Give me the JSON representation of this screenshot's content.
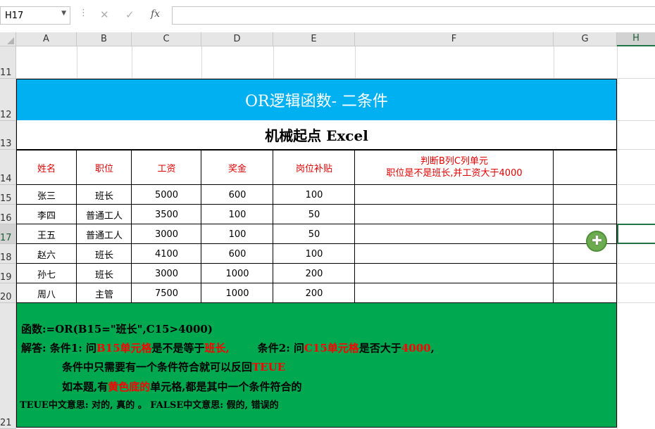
{
  "formula_bar": {
    "name_box": "H17",
    "cancel_icon": "✕",
    "enter_icon": "✓",
    "fx_label": "fx",
    "formula": ""
  },
  "columns": [
    "A",
    "B",
    "C",
    "D",
    "E",
    "F",
    "G",
    "H"
  ],
  "rows": [
    "11",
    "12",
    "13",
    "14",
    "15",
    "16",
    "17",
    "18",
    "19",
    "20",
    "21"
  ],
  "title": "OR逻辑函数- 二条件",
  "subtitle": "机械起点 Excel",
  "table": {
    "headers": [
      "姓名",
      "职位",
      "工资",
      "奖金",
      "岗位补贴"
    ],
    "judge_header_line1": "判断B列C列单元",
    "judge_header_line2": "职位是不是班长,并工资大于4000",
    "rows": [
      [
        "张三",
        "班长",
        "5000",
        "600",
        "100"
      ],
      [
        "李四",
        "普通工人",
        "3500",
        "100",
        "50"
      ],
      [
        "王五",
        "普通工人",
        "3000",
        "100",
        "50"
      ],
      [
        "赵六",
        "班长",
        "4100",
        "600",
        "100"
      ],
      [
        "孙七",
        "班长",
        "3000",
        "1000",
        "200"
      ],
      [
        "周八",
        "主管",
        "7500",
        "1000",
        "200"
      ]
    ]
  },
  "notes": {
    "line1": "函数:=OR(B15=\"班长\",C15>4000)",
    "line2_a": "解答: 条件1: 问",
    "line2_b": "B15单元格",
    "line2_c": "是不是等于",
    "line2_d": "班长,",
    "line2_e": "条件2: 问",
    "line2_f": "C15单元格",
    "line2_g": "是否大于",
    "line2_h": "4000",
    "line2_i": ",",
    "line3_a": "条件中只需要有一个条件符合就可以反回",
    "line3_b": "TEUE",
    "line4_a": "如本题,有",
    "line4_b": "黄色底的",
    "line4_c": "单元格,都是其中一个条件符合的",
    "line5": "TEUE中文意思: 对的, 真的 。 FALSE中文意思: 假的, 错误的"
  },
  "colors": {
    "title_bg": "#00b0f0",
    "notes_bg": "#00a84f",
    "header_text": "#e00000",
    "selection": "#217346"
  }
}
